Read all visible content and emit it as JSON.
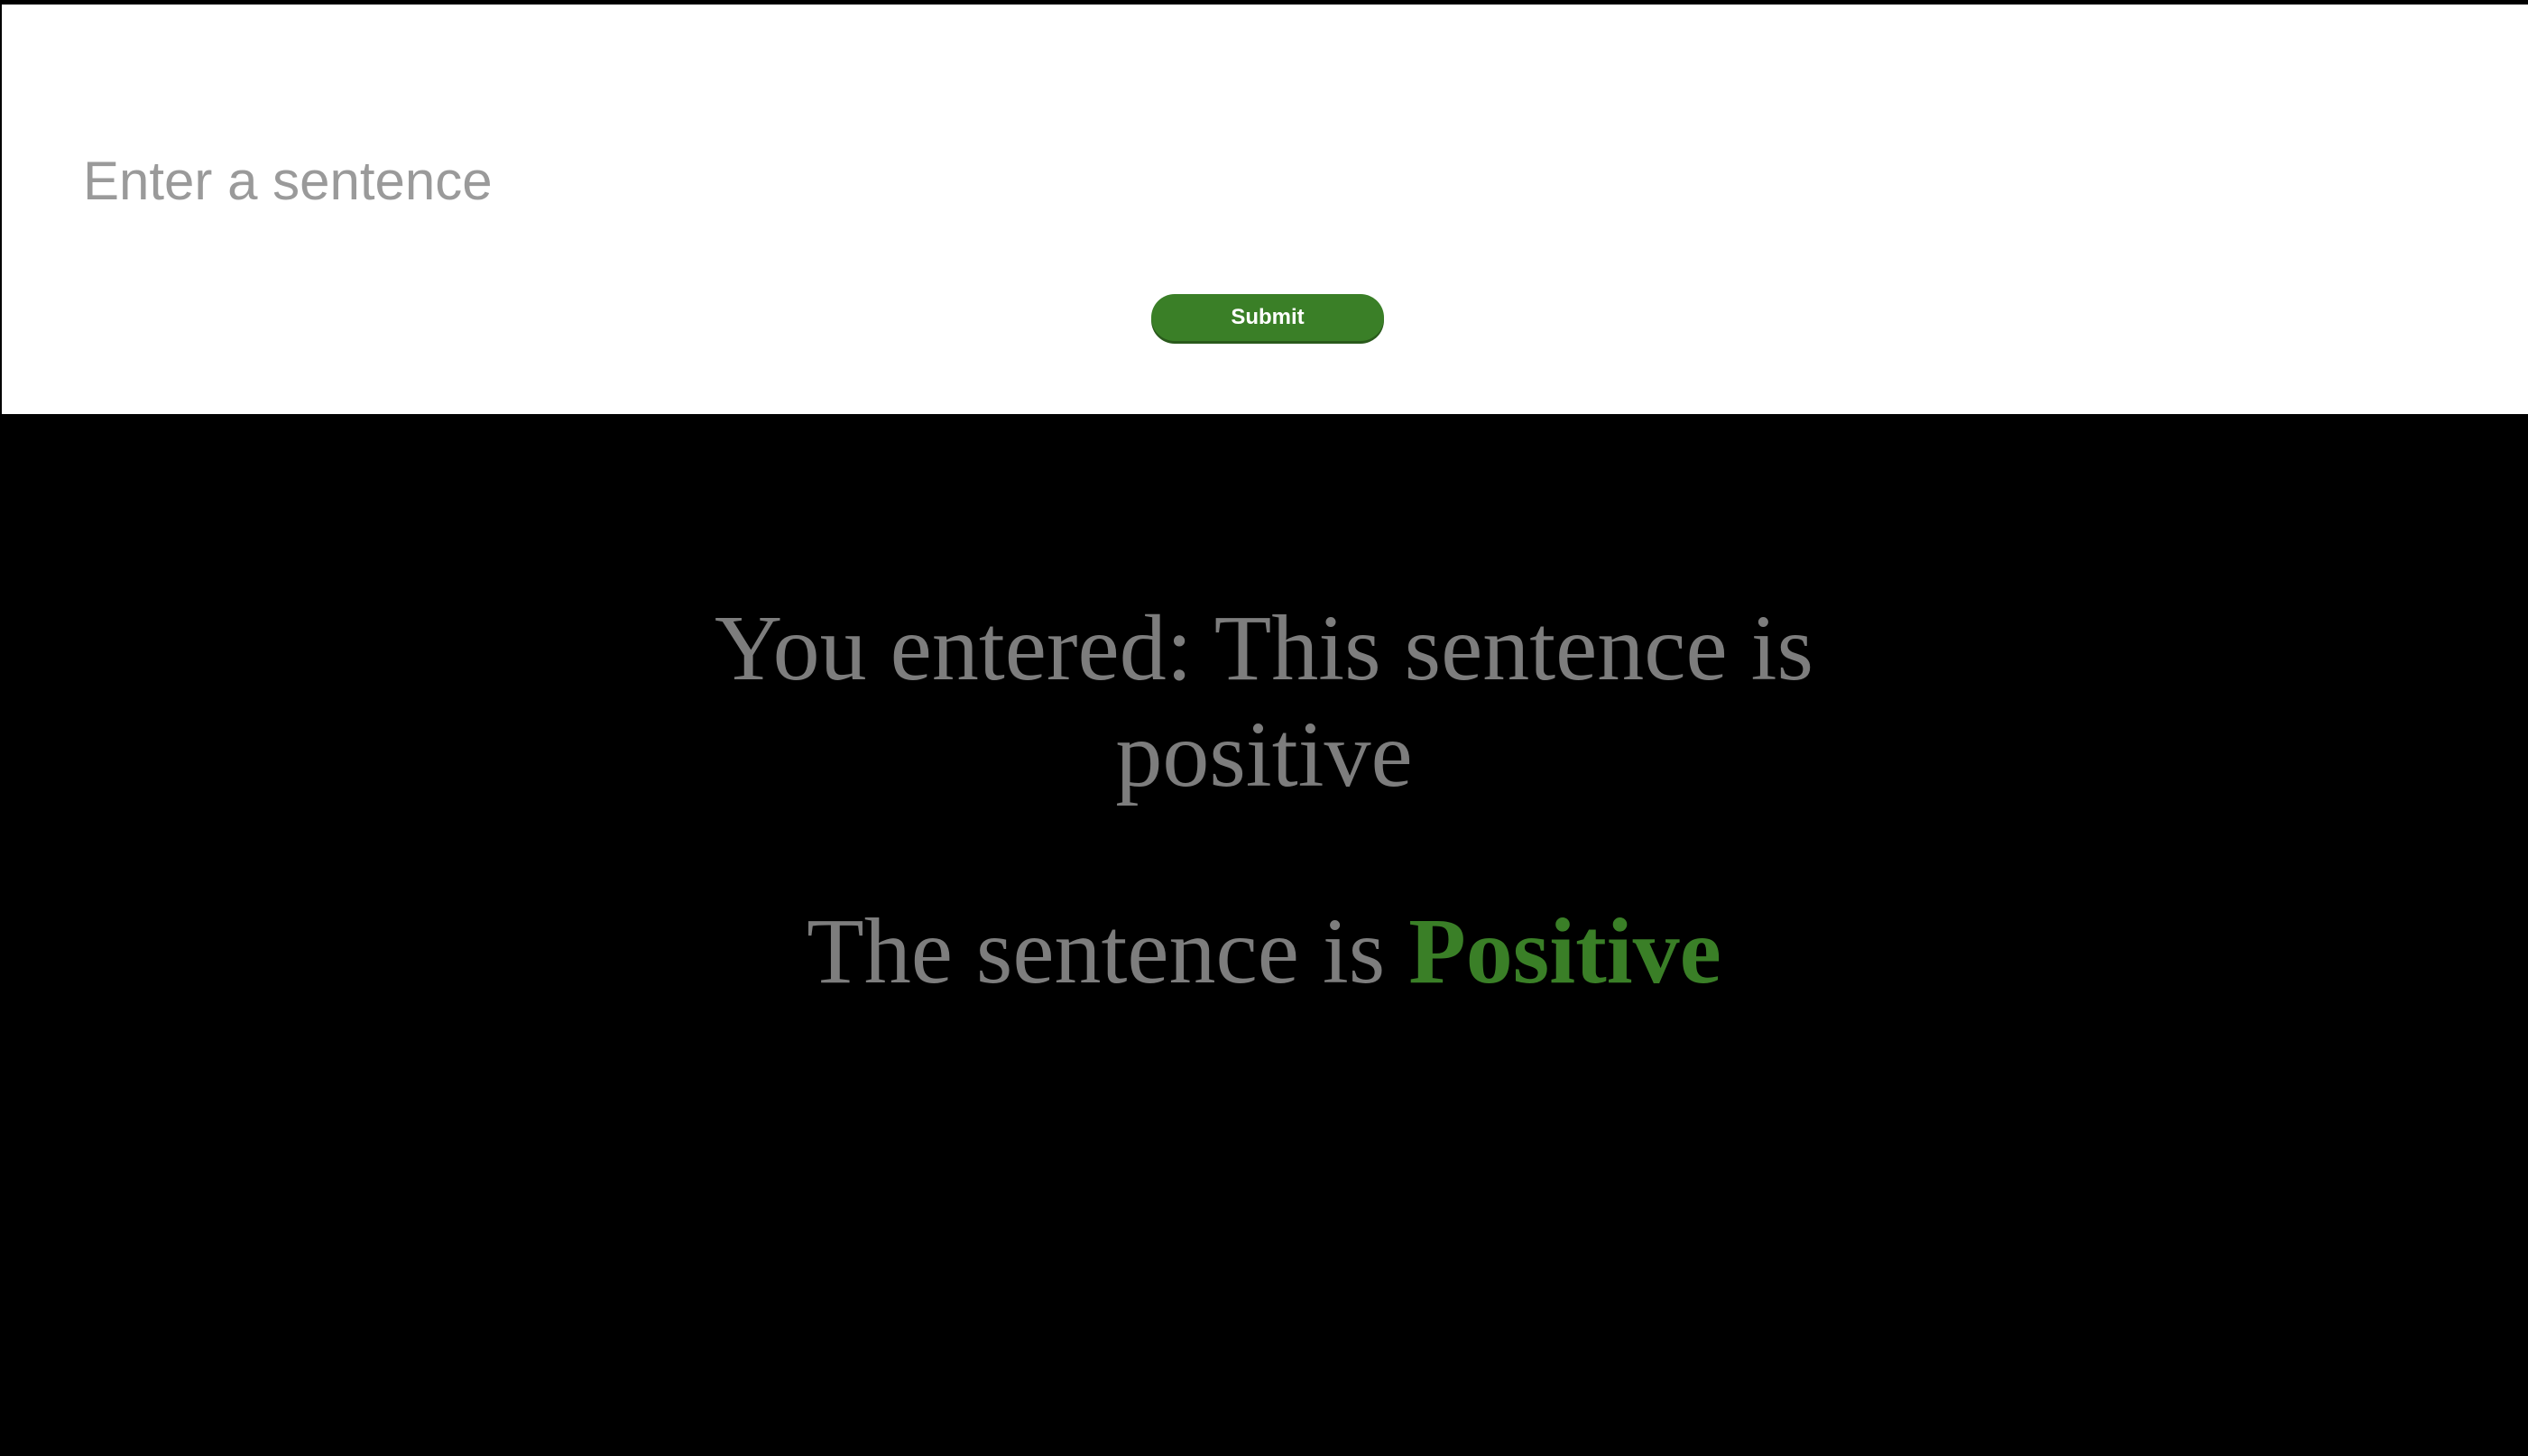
{
  "form": {
    "input_placeholder": "Enter a sentence",
    "input_value": "",
    "submit_label": "Submit"
  },
  "result": {
    "entered_prefix": "You entered:",
    "entered_text": "This sentence is positive",
    "verdict_prefix": "The sentence is",
    "verdict_value": "Positive"
  },
  "colors": {
    "accent_green": "#3a7f27",
    "text_gray": "#7d7d7d",
    "background": "#000000",
    "panel": "#ffffff"
  }
}
